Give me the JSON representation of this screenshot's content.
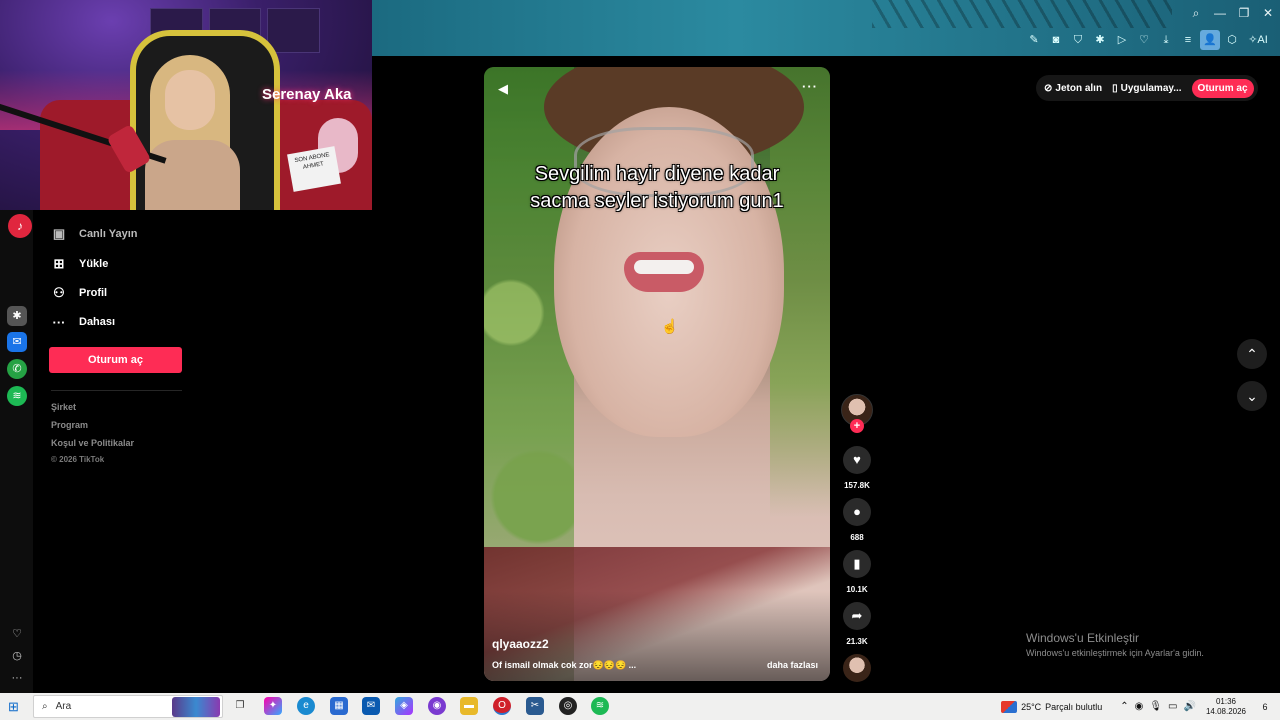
{
  "webcam": {
    "streamer_name": "Serenay Aka",
    "sign_text": "SON ABONE AHMET"
  },
  "browser": {
    "window_controls": [
      "⌕",
      "—",
      "❐",
      "✕"
    ],
    "toolbar_icons": [
      "edit-icon",
      "camera-icon",
      "shield-icon",
      "puzzle-icon",
      "play-icon",
      "heart-icon",
      "download-icon",
      "menu-icon",
      "profile-icon",
      "cube-icon",
      "ai-icon"
    ],
    "toolbar_labels": [
      "✎",
      "◙",
      "⛉",
      "✱",
      "▷",
      "♡",
      "⤓",
      "≡",
      "👤",
      "⬡",
      "✧AI"
    ]
  },
  "sidebar": {
    "partial_item": "Canlı Yayın",
    "items": [
      {
        "label": "Yükle",
        "icon": "plus-square-icon",
        "glyph": "⊞"
      },
      {
        "label": "Profil",
        "icon": "person-icon",
        "glyph": "⚇"
      },
      {
        "label": "Dahası",
        "icon": "more-dots-icon",
        "glyph": "···"
      }
    ],
    "login_button": "Oturum aç",
    "footer_links": [
      "Şirket",
      "Program",
      "Koşul ve Politikalar"
    ],
    "copyright": "© 2026 TikTok"
  },
  "header": {
    "coins": "Jeton alın",
    "app": "Uygulamay...",
    "login": "Oturum aç"
  },
  "video": {
    "caption_line1": "Sevgilim hayir diyene kadar",
    "caption_line2": "sacma seyler istiyorum gun1",
    "username": "qlyaaozz2",
    "description": "Of ismail olmak cok zor😔😔😔 ...",
    "more": "daha fazlası"
  },
  "actions": {
    "likes": "157.8K",
    "comments": "688",
    "saves": "10.1K",
    "shares": "21.3K"
  },
  "windows_activation": {
    "title": "Windows'u Etkinleştir",
    "subtitle": "Windows'u etkinleştirmek için Ayarlar'a gidin."
  },
  "taskbar": {
    "search_placeholder": "Ara",
    "weather_temp": "25°C",
    "weather_desc": "Parçalı bulutlu",
    "time": "01:36",
    "date": "14.08.2026",
    "notification_count": "6"
  },
  "colors": {
    "accent": "#fe2c55",
    "browser_bar": "#2b8aa0",
    "taskbar": "#f0f0ef"
  }
}
